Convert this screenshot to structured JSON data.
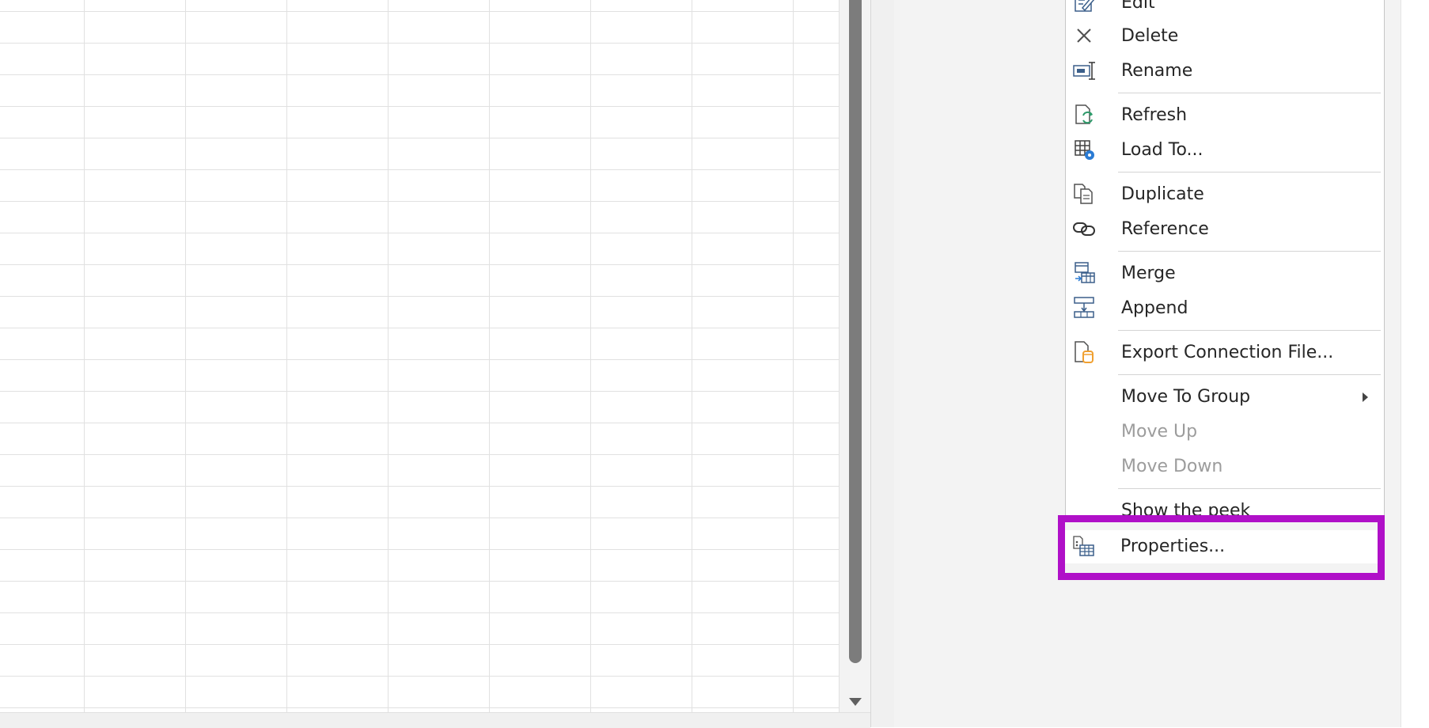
{
  "context_menu": {
    "items": [
      {
        "label": "Edit",
        "icon": "edit-icon"
      },
      {
        "label": "Delete",
        "icon": "delete-x-icon"
      },
      {
        "label": "Rename",
        "icon": "rename-icon"
      },
      {
        "label": "Refresh",
        "icon": "refresh-icon"
      },
      {
        "label": "Load To...",
        "icon": "load-to-icon"
      },
      {
        "label": "Duplicate",
        "icon": "duplicate-icon"
      },
      {
        "label": "Reference",
        "icon": "reference-icon"
      },
      {
        "label": "Merge",
        "icon": "merge-icon"
      },
      {
        "label": "Append",
        "icon": "append-icon"
      },
      {
        "label": "Export Connection File...",
        "icon": "export-connection-icon"
      },
      {
        "label": "Move To Group",
        "icon": "submenu-arrow-icon"
      },
      {
        "label": "Move Up",
        "disabled": true
      },
      {
        "label": "Move Down",
        "disabled": true
      },
      {
        "label": "Show the peek"
      },
      {
        "label": "Properties...",
        "icon": "properties-icon"
      }
    ]
  },
  "colors": {
    "highlight_border": "#b010c8",
    "refresh_green": "#2e9a6a",
    "load_blue": "#2a7bd4",
    "export_orange": "#f0a030"
  }
}
